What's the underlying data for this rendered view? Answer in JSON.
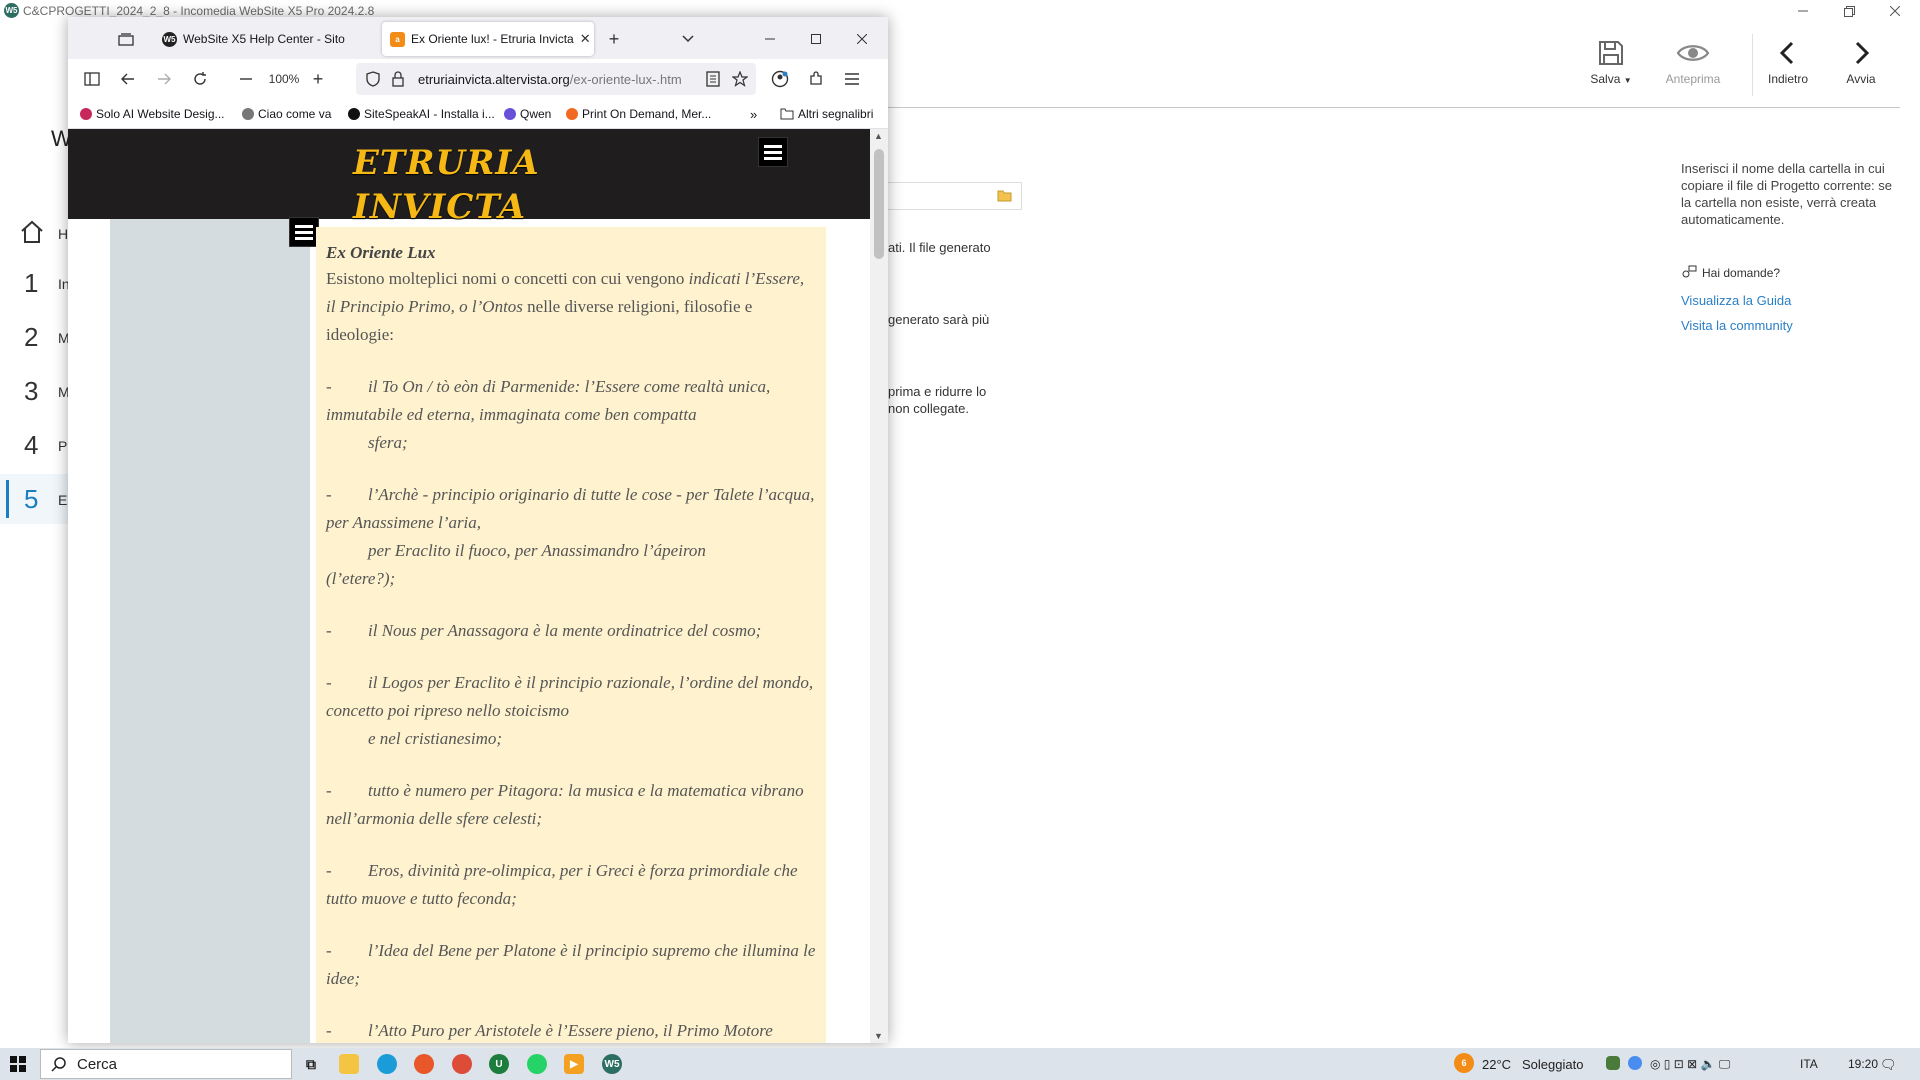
{
  "app": {
    "title": "C&CPROGETTI_2024_2_8 - Incomedia WebSite X5 Pro 2024.2.8",
    "logo_text": "W5"
  },
  "toolbar": {
    "save": "Salva",
    "preview": "Anteprima",
    "back": "Indietro",
    "next": "Avvia"
  },
  "sidebar": {
    "page_initial": "W",
    "steps": [
      {
        "num": "1",
        "label": "In"
      },
      {
        "num": "2",
        "label": "M"
      },
      {
        "num": "3",
        "label": "M"
      },
      {
        "num": "4",
        "label": "Pa"
      },
      {
        "num": "5",
        "label": "Es"
      }
    ],
    "home_label": "H"
  },
  "main": {
    "frag1": "ati. Il file generato",
    "frag2": "generato sarà più",
    "frag3a": "prima e ridurre lo",
    "frag3b": "non collegate."
  },
  "help": {
    "text": "Inserisci il nome della cartella in cui copiare il file di Progetto corrente: se la cartella non esiste, verrà creata automaticamente.",
    "ask": "Hai domande?",
    "guide": "Visualizza la Guida",
    "community": "Visita la community"
  },
  "browser": {
    "tabs": [
      {
        "title": "WebSite X5 Help Center - Sito",
        "favicon": "W5",
        "color": "#222222"
      },
      {
        "title": "Ex Oriente lux! - Etruria Invicta",
        "favicon": "a",
        "color": "#f28c17"
      }
    ],
    "zoom": "100%",
    "url_host": "etruriainvicta.altervista.org",
    "url_path": "/ex-oriente-lux-.htm",
    "bookmarks": [
      {
        "label": "Solo AI Website Desig...",
        "color": "#c7285c"
      },
      {
        "label": "Ciao come va",
        "color": "#666666"
      },
      {
        "label": "SiteSpeakAI - Installa i...",
        "color": "#111111"
      },
      {
        "label": "Qwen",
        "color": "#6a4fd8"
      },
      {
        "label": "Print On Demand, Mer...",
        "color": "#f26a21"
      }
    ],
    "other_bookmarks": "Altri segnalibri"
  },
  "site": {
    "logo_line1": "Etruria",
    "logo_line2": "Invicta",
    "heading": "Ex Oriente Lux",
    "intro_a": "Esistono molteplici nomi o concetti con cui vengono ",
    "intro_b": "indicati l’Essere, il Principio Primo, o l’Ontos",
    "intro_c": " nelle diverse religioni, filosofie e ideologie:",
    "items": [
      {
        "dash": "-",
        "text": "il To On / tò eòn di Parmenide: l’Essere come realtà unica, immutabile ed eterna, immaginata come ben compatta",
        "cont": "sfera;"
      },
      {
        "dash": "-",
        "text": "l’Archè - principio originario di tutte le cose - per Talete l’acqua, per Anassimene l’aria,",
        "cont": "per Eraclito il fuoco, per Anassimandro l’ápeiron",
        "tail": "(l’etere?);"
      },
      {
        "dash": "-",
        "text": "il Nous per Anassagora è la mente ordinatrice del cosmo;"
      },
      {
        "dash": "-",
        "text": "il Logos per Eraclito è il principio razionale, l’ordine del mondo, concetto poi ripreso nello stoicismo",
        "cont": "e nel cristianesimo;"
      },
      {
        "dash": "-",
        "text": "tutto è numero per Pitagora: la musica e la matematica vibrano nell’armonia delle sfere celesti;"
      },
      {
        "dash": "-",
        "text": "Eros, divinità pre-olimpica, per i Greci è forza primordiale che tutto muove e tutto feconda;"
      },
      {
        "dash": "-",
        "text": "l’Idea del Bene per Platone è il principio supremo che illumina le idee;"
      },
      {
        "dash": "-",
        "text": "l’Atto Puro per Aristotele è l’Essere pieno, il Primo Motore"
      }
    ]
  },
  "taskbar": {
    "search": "Cerca",
    "weather_temp": "22°C",
    "weather_text": "Soleggiato",
    "weather_badge": "6",
    "lang": "ITA",
    "time": "19:20"
  },
  "colors": {
    "accent": "#1a7fc0",
    "link": "#2a7fc7",
    "site_logo": "#f5b815",
    "article_bg": "#fef2cf"
  }
}
